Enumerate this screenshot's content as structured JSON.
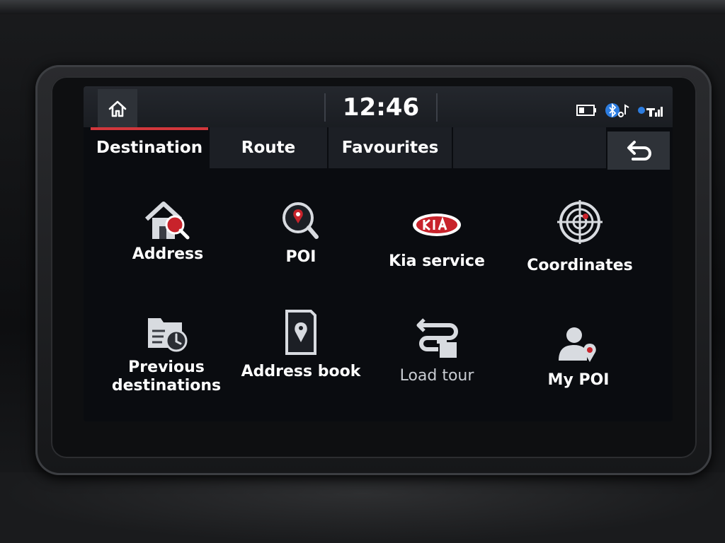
{
  "status_bar": {
    "time": "12:46",
    "icons": [
      "home-icon",
      "battery-icon",
      "bluetooth-audio-icon",
      "signal-icon"
    ]
  },
  "tabs": [
    {
      "label": "Destination",
      "active": true
    },
    {
      "label": "Route",
      "active": false
    },
    {
      "label": "Favourites",
      "active": false
    }
  ],
  "back_icon": "back-arrow-icon",
  "menu": [
    {
      "label": "Address",
      "icon": "house-search-icon"
    },
    {
      "label": "POI",
      "icon": "poi-search-icon"
    },
    {
      "label": "Kia service",
      "icon": "kia-logo-icon"
    },
    {
      "label": "Coordinates",
      "icon": "crosshair-globe-icon"
    },
    {
      "label_line1": "Previous",
      "label_line2": "destinations",
      "icon": "folder-clock-icon"
    },
    {
      "label": "Address book",
      "icon": "address-book-icon"
    },
    {
      "label": "Load tour",
      "icon": "load-tour-icon",
      "enabled": false
    },
    {
      "label": "My POI",
      "icon": "user-poi-icon"
    }
  ],
  "colors": {
    "accent": "#d2373c",
    "background": "#0a0c10",
    "text": "#ffffff"
  }
}
